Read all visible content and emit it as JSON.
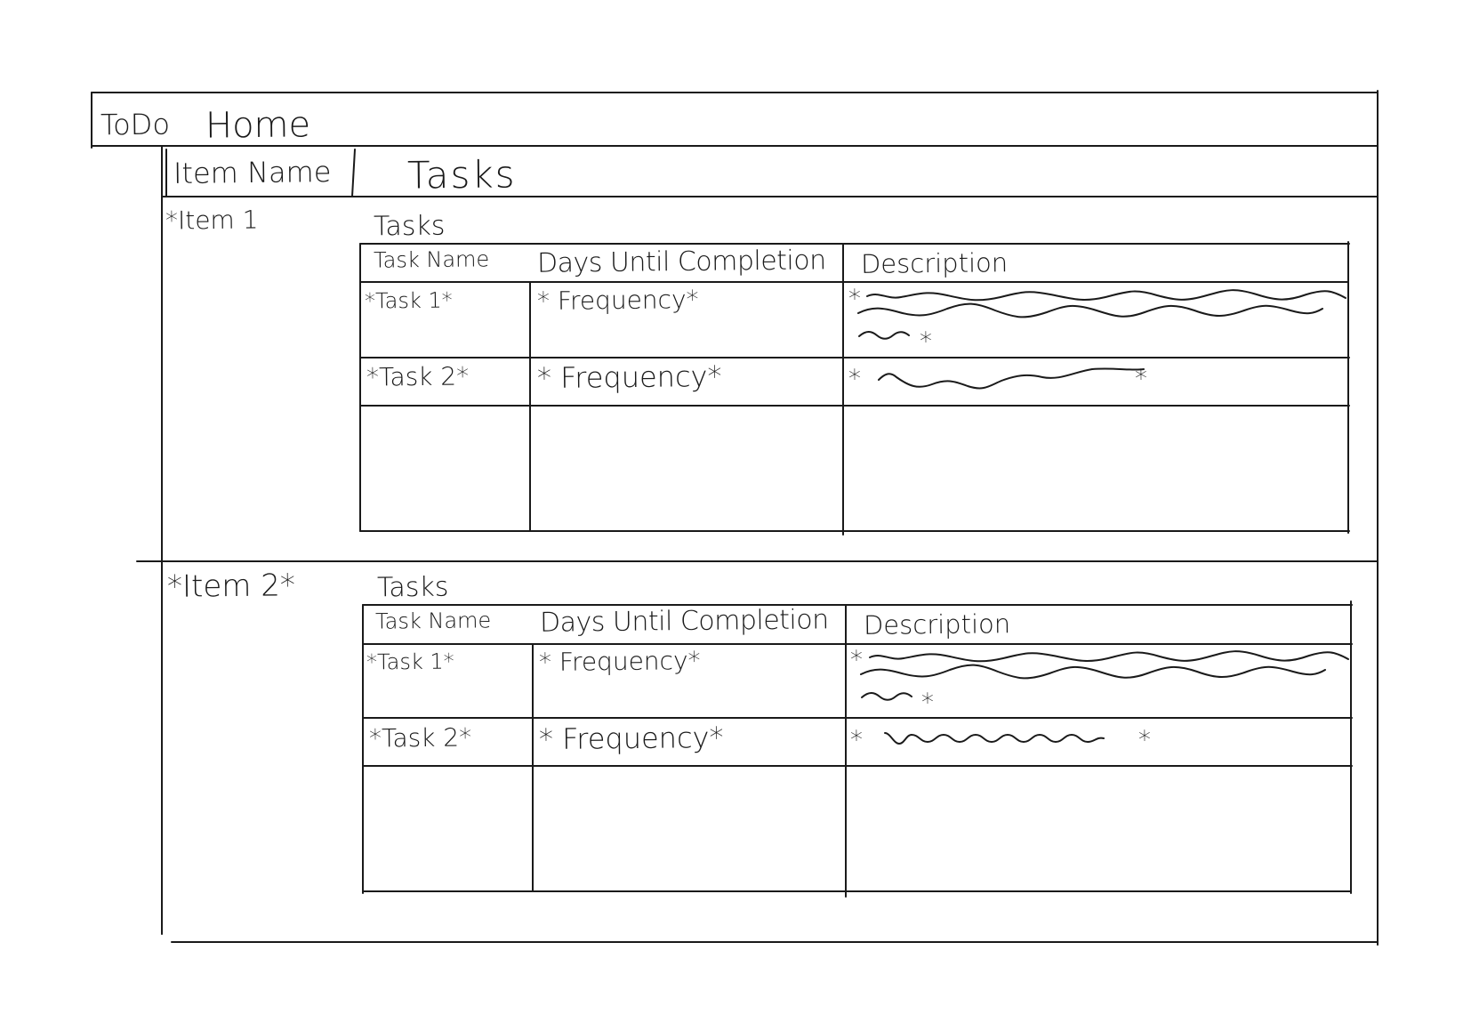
{
  "nav": {
    "app_title": "ToDo",
    "home_link": "Home"
  },
  "header": {
    "item_name_heading": "Item Name",
    "tasks_heading": "Tasks"
  },
  "items": [
    {
      "label": "*Item 1",
      "tasks_label": "Tasks",
      "columns": [
        "Task Name",
        "Days Until Completion",
        "Description"
      ],
      "rows": [
        {
          "name": "*Task 1*",
          "days": "* Frequency*",
          "description_start": "*",
          "description_end": "*"
        },
        {
          "name": "*Task 2*",
          "days": "* Frequency*",
          "description_start": "*",
          "description_end": "*"
        }
      ]
    },
    {
      "label": "*Item 2*",
      "tasks_label": "Tasks",
      "columns": [
        "Task Name",
        "Days Until Completion",
        "Description"
      ],
      "rows": [
        {
          "name": "*Task 1*",
          "days": "* Frequency*",
          "description_start": "*",
          "description_end": "*"
        },
        {
          "name": "*Task 2*",
          "days": "* Frequency*",
          "description_start": "*",
          "description_end": "*"
        }
      ]
    }
  ]
}
